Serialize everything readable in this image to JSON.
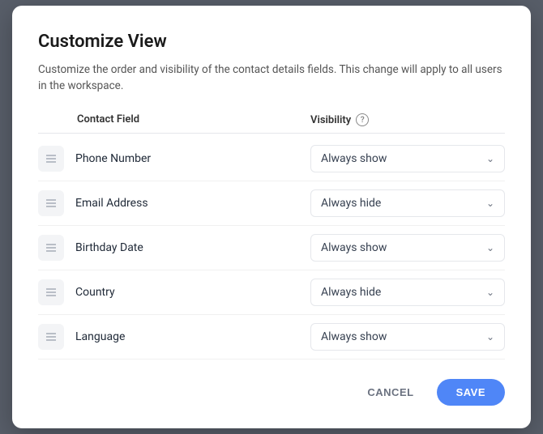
{
  "modal": {
    "title": "Customize View",
    "description": "Customize the order and visibility of the contact details fields. This change will apply to all users in the workspace.",
    "table": {
      "col_field": "Contact Field",
      "col_visibility": "Visibility"
    },
    "rows": [
      {
        "id": "phone",
        "name": "Phone Number",
        "visibility": "Always show"
      },
      {
        "id": "email",
        "name": "Email Address",
        "visibility": "Always hide"
      },
      {
        "id": "birthday",
        "name": "Birthday Date",
        "visibility": "Always show"
      },
      {
        "id": "country",
        "name": "Country",
        "visibility": "Always hide"
      },
      {
        "id": "language",
        "name": "Language",
        "visibility": "Always show"
      }
    ],
    "footer": {
      "cancel_label": "CANCEL",
      "save_label": "SAVE"
    }
  }
}
